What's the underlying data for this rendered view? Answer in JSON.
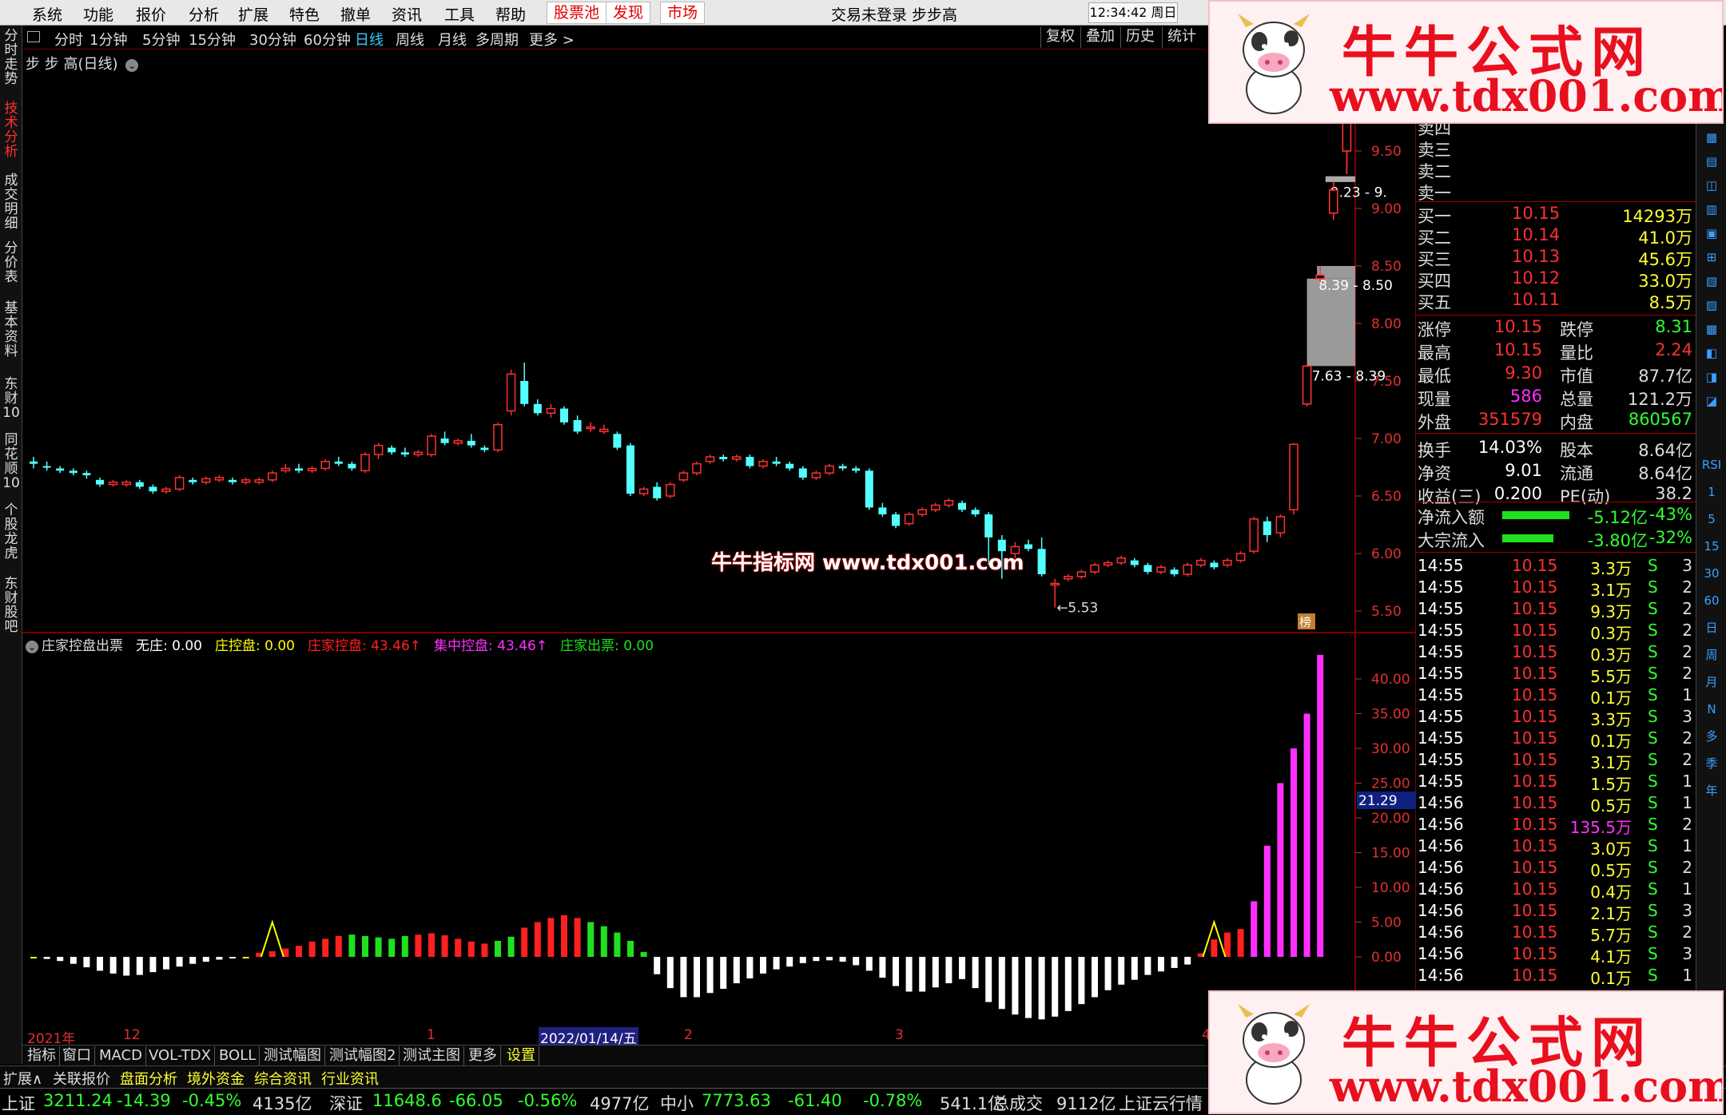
{
  "menubar": {
    "items": [
      "系统",
      "功能",
      "报价",
      "分析",
      "扩展",
      "特色",
      "撤单",
      "资讯",
      "工具",
      "帮助"
    ],
    "red_items": [
      "股票池",
      "发现",
      "市场"
    ],
    "login_status": "交易未登录 步步高",
    "clock": "12:34:42 周日"
  },
  "sidebar": {
    "tabs": [
      "分时走势",
      "技术分析",
      "成交明细",
      "分价表",
      "基本资料",
      "东财10",
      "同花顺10",
      "个股龙虎",
      "东财股吧"
    ],
    "active": "技术分析"
  },
  "periods": {
    "items": [
      "分时",
      "1分钟",
      "5分钟",
      "15分钟",
      "30分钟",
      "60分钟",
      "日线",
      "周线",
      "月线",
      "多周期",
      "更多 >"
    ],
    "selected": "日线",
    "tools": [
      "复权",
      "叠加",
      "历史",
      "统计"
    ]
  },
  "main_chart": {
    "title": "步 步 高(日线)",
    "low_label": "←5.53",
    "gap_labels": [
      "9.23 - 9.",
      "8.39 - 8.50",
      "7.63 - 8.39"
    ],
    "yaxis": [
      "9.50",
      "9.00",
      "8.50",
      "8.00",
      "7.50",
      "7.00",
      "6.50",
      "6.00",
      "5.50"
    ],
    "badge": "榜"
  },
  "indicator": {
    "name": "庄家控盘出票",
    "values": [
      {
        "label": "无庄: 0.00",
        "color": "#ffffff"
      },
      {
        "label": "庄控盘: 0.00",
        "color": "#ffff00"
      },
      {
        "label": "庄家控盘: 43.46↑",
        "color": "#ff2020"
      },
      {
        "label": "集中控盘: 43.46↑",
        "color": "#ff30ff"
      },
      {
        "label": "庄家出票: 0.00",
        "color": "#20e020"
      }
    ],
    "yaxis": [
      "40.00",
      "35.00",
      "30.00",
      "25.00",
      "20.00",
      "15.00",
      "10.00",
      "5.00",
      "0.00"
    ],
    "cursor_value": "21.29",
    "bars": [
      0,
      -0.3,
      -0.6,
      -1,
      -1.5,
      -2,
      -2.4,
      -2.7,
      -2.6,
      -2.2,
      -1.8,
      -1.4,
      -1,
      -0.7,
      -0.4,
      -0.2,
      0,
      0.6,
      0.8,
      1.2,
      1.6,
      2.2,
      2.6,
      3,
      3.2,
      3,
      2.8,
      2.6,
      3,
      3.2,
      3.4,
      3.1,
      2.6,
      2.2,
      1.9,
      2.3,
      2.9,
      4.2,
      5,
      5.6,
      6,
      5.6,
      5,
      4.4,
      3.5,
      2.3,
      0.7,
      -2.5,
      -4.5,
      -5.8,
      -5.8,
      -5.2,
      -4.6,
      -3.8,
      -3.1,
      -2.4,
      -1.8,
      -1.4,
      -0.9,
      -0.6,
      -0.5,
      -0.7,
      -1.2,
      -2,
      -3,
      -4.2,
      -5,
      -5,
      -4.4,
      -3.8,
      -3.2,
      -4.5,
      -6.5,
      -7.5,
      -8.3,
      -8.8,
      -9,
      -8.6,
      -7.8,
      -6.8,
      -5.8,
      -4.8,
      -4,
      -3.3,
      -2.6,
      -2.1,
      -1.6,
      -1.1,
      0.5,
      2.5,
      3.5,
      4,
      8,
      16,
      25,
      30,
      35,
      43.46
    ],
    "triangles": [
      18,
      89
    ]
  },
  "quote": {
    "sell_labels": [
      "卖四",
      "卖三",
      "卖二",
      "卖一"
    ],
    "buy": [
      {
        "label": "买一",
        "price": "10.15",
        "vol": "14293万"
      },
      {
        "label": "买二",
        "price": "10.14",
        "vol": "41.0万"
      },
      {
        "label": "买三",
        "price": "10.13",
        "vol": "45.6万"
      },
      {
        "label": "买四",
        "price": "10.12",
        "vol": "33.0万"
      },
      {
        "label": "买五",
        "price": "10.11",
        "vol": "8.5万"
      }
    ],
    "stats": [
      {
        "l1": "涨停",
        "v1": "10.15",
        "c1": "#ff3030",
        "l2": "跌停",
        "v2": "8.31",
        "c2": "#30ff30"
      },
      {
        "l1": "最高",
        "v1": "10.15",
        "c1": "#ff3030",
        "l2": "量比",
        "v2": "2.24",
        "c2": "#ff3030"
      },
      {
        "l1": "最低",
        "v1": "9.30",
        "c1": "#ff3030",
        "l2": "市值",
        "v2": "87.7亿",
        "c2": "#dddddd"
      },
      {
        "l1": "现量",
        "v1": "586",
        "c1": "#ff30ff",
        "l2": "总量",
        "v2": "121.2万",
        "c2": "#dddddd"
      },
      {
        "l1": "外盘",
        "v1": "351579",
        "c1": "#ff3030",
        "l2": "内盘",
        "v2": "860567",
        "c2": "#30ff30"
      },
      {
        "l1": "换手",
        "v1": "14.03%",
        "c1": "#ffffff",
        "l2": "股本",
        "v2": "8.64亿",
        "c2": "#dddddd"
      },
      {
        "l1": "净资",
        "v1": "9.01",
        "c1": "#ffffff",
        "l2": "流通",
        "v2": "8.64亿",
        "c2": "#dddddd"
      },
      {
        "l1": "收益(三)",
        "v1": "0.200",
        "c1": "#ffffff",
        "l2": "PE(动)",
        "v2": "38.2",
        "c2": "#dddddd"
      }
    ],
    "flows": [
      {
        "label": "净流入额",
        "value": "-5.12亿",
        "pct": "-43%"
      },
      {
        "label": "大宗流入",
        "value": "-3.80亿",
        "pct": "-32%"
      }
    ]
  },
  "ticks": [
    {
      "t": "14:55",
      "p": "10.15",
      "v": "3.3万",
      "s": "S",
      "n": "3"
    },
    {
      "t": "14:55",
      "p": "10.15",
      "v": "3.1万",
      "s": "S",
      "n": "2"
    },
    {
      "t": "14:55",
      "p": "10.15",
      "v": "9.3万",
      "s": "S",
      "n": "2"
    },
    {
      "t": "14:55",
      "p": "10.15",
      "v": "0.3万",
      "s": "S",
      "n": "2"
    },
    {
      "t": "14:55",
      "p": "10.15",
      "v": "0.3万",
      "s": "S",
      "n": "2"
    },
    {
      "t": "14:55",
      "p": "10.15",
      "v": "5.5万",
      "s": "S",
      "n": "2"
    },
    {
      "t": "14:55",
      "p": "10.15",
      "v": "0.1万",
      "s": "S",
      "n": "1"
    },
    {
      "t": "14:55",
      "p": "10.15",
      "v": "3.3万",
      "s": "S",
      "n": "3"
    },
    {
      "t": "14:55",
      "p": "10.15",
      "v": "0.1万",
      "s": "S",
      "n": "2"
    },
    {
      "t": "14:55",
      "p": "10.15",
      "v": "3.1万",
      "s": "S",
      "n": "2"
    },
    {
      "t": "14:55",
      "p": "10.15",
      "v": "1.5万",
      "s": "S",
      "n": "1"
    },
    {
      "t": "14:56",
      "p": "10.15",
      "v": "0.5万",
      "s": "S",
      "n": "1"
    },
    {
      "t": "14:56",
      "p": "10.15",
      "v": "135.5万",
      "s": "S",
      "n": "2"
    },
    {
      "t": "14:56",
      "p": "10.15",
      "v": "3.0万",
      "s": "S",
      "n": "1"
    },
    {
      "t": "14:56",
      "p": "10.15",
      "v": "0.5万",
      "s": "S",
      "n": "2"
    },
    {
      "t": "14:56",
      "p": "10.15",
      "v": "0.4万",
      "s": "S",
      "n": "1"
    },
    {
      "t": "14:56",
      "p": "10.15",
      "v": "2.1万",
      "s": "S",
      "n": "3"
    },
    {
      "t": "14:56",
      "p": "10.15",
      "v": "5.7万",
      "s": "S",
      "n": "2"
    },
    {
      "t": "14:56",
      "p": "10.15",
      "v": "4.1万",
      "s": "S",
      "n": "3"
    },
    {
      "t": "14:56",
      "p": "10.15",
      "v": "0.1万",
      "s": "S",
      "n": "1"
    }
  ],
  "right_icons": [
    "RSI",
    "1",
    "5",
    "15",
    "30",
    "60",
    "日",
    "周",
    "月",
    "N",
    "多",
    "季",
    "年"
  ],
  "datebar": [
    "2021年",
    "12",
    "1",
    "2022/01/14/五",
    "2",
    "3",
    "4"
  ],
  "indtabs": [
    "指标",
    "窗口",
    "MACD",
    "VOL-TDX",
    "BOLL",
    "测试幅图",
    "测试幅图2",
    "测试主图",
    "更多",
    "设置"
  ],
  "bottomtabs": [
    "扩展∧",
    "关联报价",
    "盘面分析",
    "境外资金",
    "综合资讯",
    "行业资讯"
  ],
  "ticker": [
    {
      "text": "上证",
      "color": "#dddddd"
    },
    {
      "text": "3211.24",
      "color": "#30ff30"
    },
    {
      "text": "-14.39",
      "color": "#30ff30"
    },
    {
      "text": "-0.45%",
      "color": "#30ff30"
    },
    {
      "text": "4135亿",
      "color": "#dddddd"
    },
    {
      "text": "深证",
      "color": "#dddddd"
    },
    {
      "text": "11648.6",
      "color": "#30ff30"
    },
    {
      "text": "-66.05",
      "color": "#30ff30"
    },
    {
      "text": "-0.56%",
      "color": "#30ff30"
    },
    {
      "text": "4977亿",
      "color": "#dddddd"
    },
    {
      "text": "中小",
      "color": "#dddddd"
    },
    {
      "text": "7773.63",
      "color": "#30ff30"
    },
    {
      "text": "-61.40",
      "color": "#30ff30"
    },
    {
      "text": "-0.78%",
      "color": "#30ff30"
    },
    {
      "text": "541.1亿",
      "color": "#dddddd"
    },
    {
      "text": "总成交",
      "color": "#dddddd"
    },
    {
      "text": "9112亿",
      "color": "#dddddd"
    },
    {
      "text": "上证云行情",
      "color": "#dddddd"
    }
  ],
  "ads": {
    "title": "牛牛公式网",
    "url": "www.tdx001.com"
  },
  "watermark": "牛牛指标网 www.tdx001.com",
  "candles": [
    [
      6.8,
      6.78,
      6.84,
      6.74
    ],
    [
      6.76,
      6.75,
      6.8,
      6.72
    ],
    [
      6.74,
      6.72,
      6.76,
      6.7
    ],
    [
      6.72,
      6.7,
      6.74,
      6.68
    ],
    [
      6.7,
      6.68,
      6.72,
      6.65
    ],
    [
      6.64,
      6.6,
      6.66,
      6.58
    ],
    [
      6.6,
      6.62,
      6.64,
      6.58
    ],
    [
      6.6,
      6.62,
      6.64,
      6.58
    ],
    [
      6.62,
      6.58,
      6.64,
      6.56
    ],
    [
      6.58,
      6.54,
      6.6,
      6.52
    ],
    [
      6.54,
      6.56,
      6.58,
      6.52
    ],
    [
      6.56,
      6.66,
      6.68,
      6.54
    ],
    [
      6.64,
      6.62,
      6.66,
      6.6
    ],
    [
      6.62,
      6.65,
      6.67,
      6.6
    ],
    [
      6.64,
      6.66,
      6.68,
      6.62
    ],
    [
      6.64,
      6.62,
      6.66,
      6.6
    ],
    [
      6.62,
      6.64,
      6.66,
      6.6
    ],
    [
      6.62,
      6.64,
      6.66,
      6.6
    ],
    [
      6.64,
      6.7,
      6.72,
      6.62
    ],
    [
      6.72,
      6.74,
      6.78,
      6.7
    ],
    [
      6.74,
      6.72,
      6.78,
      6.7
    ],
    [
      6.72,
      6.74,
      6.76,
      6.7
    ],
    [
      6.74,
      6.8,
      6.82,
      6.72
    ],
    [
      6.8,
      6.78,
      6.84,
      6.76
    ],
    [
      6.78,
      6.74,
      6.8,
      6.72
    ],
    [
      6.72,
      6.86,
      6.88,
      6.7
    ],
    [
      6.86,
      6.94,
      6.96,
      6.82
    ],
    [
      6.92,
      6.88,
      6.94,
      6.86
    ],
    [
      6.88,
      6.86,
      6.92,
      6.84
    ],
    [
      6.86,
      6.88,
      6.9,
      6.84
    ],
    [
      6.86,
      7.02,
      7.04,
      6.84
    ],
    [
      7.0,
      6.96,
      7.06,
      6.94
    ],
    [
      6.96,
      6.98,
      7.0,
      6.94
    ],
    [
      6.98,
      6.94,
      7.04,
      6.92
    ],
    [
      6.92,
      6.9,
      6.94,
      6.88
    ],
    [
      6.9,
      7.12,
      7.14,
      6.88
    ],
    [
      7.24,
      7.56,
      7.6,
      7.2
    ],
    [
      7.5,
      7.3,
      7.66,
      7.28
    ],
    [
      7.3,
      7.22,
      7.34,
      7.2
    ],
    [
      7.22,
      7.26,
      7.3,
      7.18
    ],
    [
      7.26,
      7.14,
      7.28,
      7.12
    ],
    [
      7.16,
      7.06,
      7.2,
      7.04
    ],
    [
      7.1,
      7.1,
      7.14,
      7.06
    ],
    [
      7.06,
      7.08,
      7.12,
      7.04
    ],
    [
      7.04,
      6.92,
      7.06,
      6.9
    ],
    [
      6.94,
      6.52,
      6.96,
      6.5
    ],
    [
      6.52,
      6.56,
      6.58,
      6.5
    ],
    [
      6.58,
      6.48,
      6.62,
      6.46
    ],
    [
      6.5,
      6.6,
      6.62,
      6.48
    ],
    [
      6.64,
      6.7,
      6.72,
      6.62
    ],
    [
      6.7,
      6.78,
      6.8,
      6.68
    ],
    [
      6.8,
      6.84,
      6.86,
      6.78
    ],
    [
      6.84,
      6.82,
      6.86,
      6.8
    ],
    [
      6.82,
      6.84,
      6.86,
      6.8
    ],
    [
      6.84,
      6.76,
      6.86,
      6.74
    ],
    [
      6.76,
      6.8,
      6.82,
      6.74
    ],
    [
      6.8,
      6.78,
      6.84,
      6.76
    ],
    [
      6.78,
      6.74,
      6.8,
      6.72
    ],
    [
      6.74,
      6.66,
      6.76,
      6.64
    ],
    [
      6.66,
      6.7,
      6.72,
      6.64
    ],
    [
      6.7,
      6.76,
      6.78,
      6.68
    ],
    [
      6.76,
      6.74,
      6.78,
      6.72
    ],
    [
      6.74,
      6.72,
      6.76,
      6.7
    ],
    [
      6.72,
      6.4,
      6.74,
      6.38
    ],
    [
      6.4,
      6.34,
      6.44,
      6.32
    ],
    [
      6.34,
      6.24,
      6.36,
      6.22
    ],
    [
      6.26,
      6.34,
      6.36,
      6.24
    ],
    [
      6.34,
      6.38,
      6.4,
      6.32
    ],
    [
      6.38,
      6.42,
      6.44,
      6.36
    ],
    [
      6.42,
      6.46,
      6.48,
      6.4
    ],
    [
      6.44,
      6.38,
      6.46,
      6.36
    ],
    [
      6.38,
      6.34,
      6.4,
      6.32
    ],
    [
      6.34,
      6.14,
      6.36,
      5.9
    ],
    [
      6.12,
      6.02,
      6.16,
      5.78
    ],
    [
      6.0,
      6.06,
      6.1,
      5.96
    ],
    [
      6.08,
      6.04,
      6.12,
      6.02
    ],
    [
      6.04,
      5.82,
      6.14,
      5.8
    ],
    [
      5.74,
      5.74,
      5.78,
      5.53
    ],
    [
      5.78,
      5.8,
      5.82,
      5.76
    ],
    [
      5.8,
      5.84,
      5.86,
      5.78
    ],
    [
      5.84,
      5.9,
      5.92,
      5.82
    ],
    [
      5.9,
      5.92,
      5.94,
      5.88
    ],
    [
      5.92,
      5.96,
      5.98,
      5.9
    ],
    [
      5.94,
      5.9,
      5.96,
      5.88
    ],
    [
      5.9,
      5.84,
      5.92,
      5.82
    ],
    [
      5.84,
      5.88,
      5.9,
      5.82
    ],
    [
      5.86,
      5.82,
      5.88,
      5.8
    ],
    [
      5.82,
      5.9,
      5.92,
      5.8
    ],
    [
      5.9,
      5.94,
      5.96,
      5.88
    ],
    [
      5.92,
      5.88,
      5.94,
      5.86
    ],
    [
      5.9,
      5.94,
      5.96,
      5.88
    ],
    [
      5.94,
      6.0,
      6.02,
      5.92
    ],
    [
      6.02,
      6.3,
      6.32,
      6.0
    ],
    [
      6.28,
      6.16,
      6.32,
      6.1
    ],
    [
      6.18,
      6.32,
      6.34,
      6.14
    ],
    [
      6.38,
      6.95,
      6.96,
      6.34
    ],
    [
      7.3,
      7.63,
      7.64,
      7.28
    ],
    [
      8.39,
      8.42,
      8.5,
      8.36
    ],
    [
      8.96,
      9.16,
      9.23,
      8.9
    ],
    [
      9.5,
      9.9,
      10.15,
      9.3
    ]
  ]
}
